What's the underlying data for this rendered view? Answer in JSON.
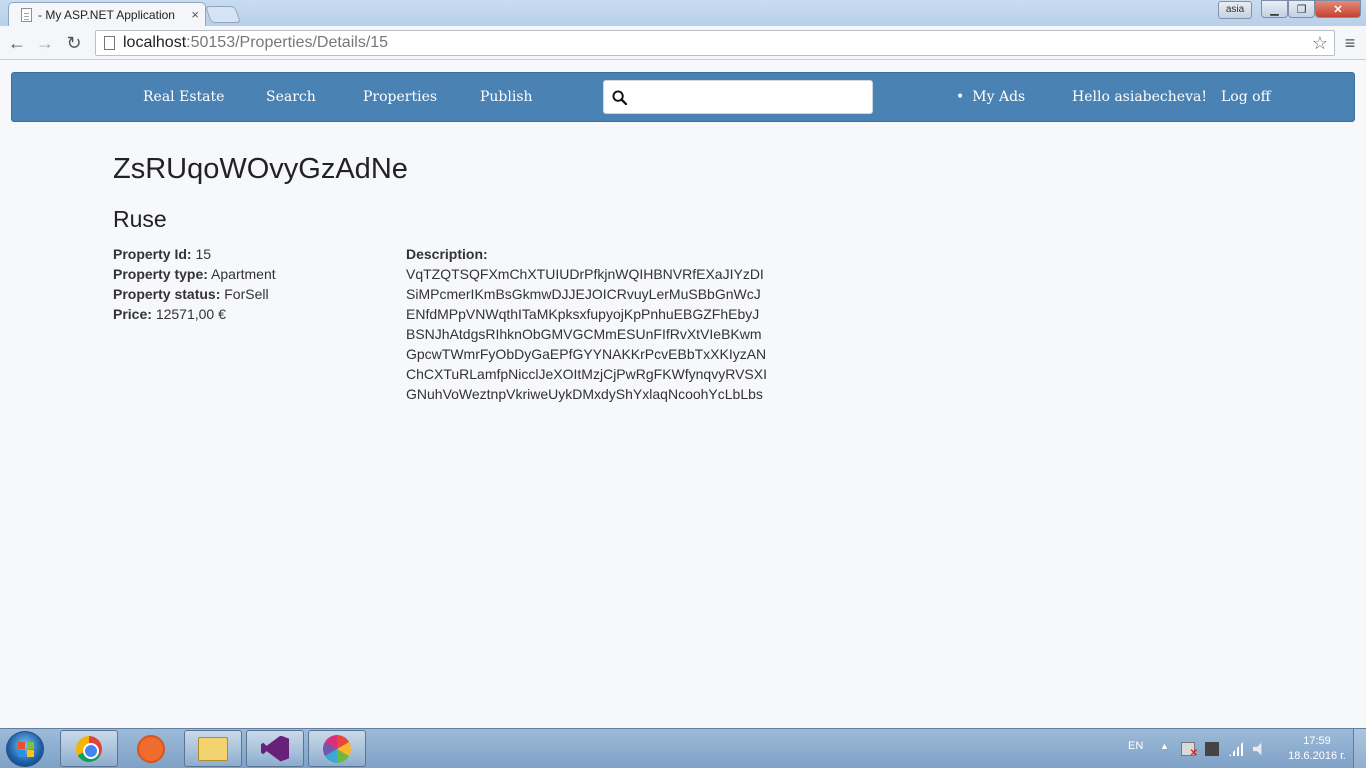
{
  "browser": {
    "tab_title": "- My ASP.NET Application",
    "tab_close": "×",
    "url_host": "localhost",
    "url_path": ":50153/Properties/Details/15",
    "user_badge": "asia",
    "icons": [
      "back-arrow-icon",
      "forward-arrow-icon",
      "reload-icon",
      "page-icon",
      "star-icon",
      "menu-icon"
    ]
  },
  "navbar": {
    "brand": "Real Estate",
    "search": "Search",
    "properties": "Properties",
    "publish": "Publish",
    "search_value": "",
    "my_ads": "My Ads",
    "hello": "Hello asiabecheva!",
    "log_off": "Log off"
  },
  "property": {
    "title": "ZsRUqoWOvyGzAdNe",
    "city": "Ruse",
    "id_label": "Property Id:",
    "id_value": "15",
    "type_label": "Property type:",
    "type_value": "Apartment",
    "status_label": "Property status:",
    "status_value": "ForSell",
    "price_label": "Price:",
    "price_value": "12571,00 €",
    "description_label": "Description:",
    "description_lines": [
      "VqTZQTSQFXmChXTUIUDrPfkjnWQIHBNVRfEXaJIYzDI",
      "SiMPcmerIKmBsGkmwDJJEJOICRvuyLerMuSBbGnWcJ",
      "ENfdMPpVNWqthITaMKpksxfupyojKpPnhuEBGZFhEbyJ",
      "BSNJhAtdgsRIhknObGMVGCMmESUnFIfRvXtVIeBKwm",
      "GpcwTWmrFyObDyGaEPfGYYNAKKrPcvEBbTxXKIyzAN",
      "ChCXTuRLamfpNicclJeXOItMzjCjPwRgFKWfynqvyRVSXI",
      "GNuhVoWeztnpVkriweUykDMxdyShYxlaqNcoohYcLbLbs"
    ]
  },
  "taskbar": {
    "language": "EN",
    "time": "17:59",
    "date": "18.6.2016 г.",
    "apps": [
      "chrome-icon",
      "tool-icon",
      "folder-icon",
      "visual-studio-icon",
      "picasa-icon"
    ]
  }
}
